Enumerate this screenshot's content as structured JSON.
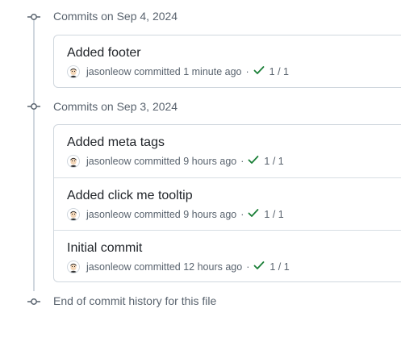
{
  "groups": [
    {
      "header": "Commits on Sep 4, 2024",
      "commits": [
        {
          "title": "Added footer",
          "author": "jasonleow",
          "verb": "committed",
          "time": "1 minute ago",
          "checks": "1 / 1"
        }
      ]
    },
    {
      "header": "Commits on Sep 3, 2024",
      "commits": [
        {
          "title": "Added meta tags",
          "author": "jasonleow",
          "verb": "committed",
          "time": "9 hours ago",
          "checks": "1 / 1"
        },
        {
          "title": "Added click me tooltip",
          "author": "jasonleow",
          "verb": "committed",
          "time": "9 hours ago",
          "checks": "1 / 1"
        },
        {
          "title": "Initial commit",
          "author": "jasonleow",
          "verb": "committed",
          "time": "12 hours ago",
          "checks": "1 / 1"
        }
      ]
    }
  ],
  "footer": "End of commit history for this file",
  "colors": {
    "check": "#1a7f37",
    "muted": "#59636e",
    "border": "#d0d7de"
  },
  "icons": {
    "timeline": "git-commit-icon",
    "status": "check-icon",
    "avatar": "user-avatar"
  }
}
